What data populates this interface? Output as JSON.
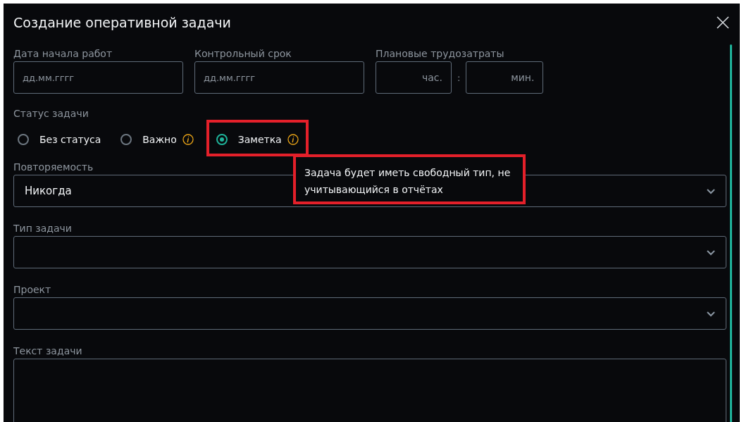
{
  "dialog": {
    "title": "Создание оперативной задачи"
  },
  "dates": [
    {
      "label": "Дата начала работ",
      "placeholder": "дд.мм.гггг"
    },
    {
      "label": "Контрольный срок",
      "placeholder": "дд.мм.гггг"
    }
  ],
  "planned_effort": {
    "label": "Плановые трудозатраты",
    "hours_placeholder": "час.",
    "separator": ":",
    "minutes_placeholder": "мин."
  },
  "status": {
    "label": "Статус задачи",
    "options": [
      {
        "label": "Без статуса",
        "selected": false,
        "info": false,
        "highlighted": false
      },
      {
        "label": "Важно",
        "selected": false,
        "info": true,
        "highlighted": false
      },
      {
        "label": "Заметка",
        "selected": true,
        "info": true,
        "highlighted": true
      }
    ]
  },
  "tooltip": {
    "text": "Задача будет иметь свободный тип, не учитывающийся в  отчётах",
    "highlighted": true
  },
  "selects": [
    {
      "label": "Повторяемость",
      "value": "Никогда"
    },
    {
      "label": "Тип задачи"
    },
    {
      "label": "Проект"
    }
  ],
  "task_text": {
    "label": "Текст задачи"
  }
}
